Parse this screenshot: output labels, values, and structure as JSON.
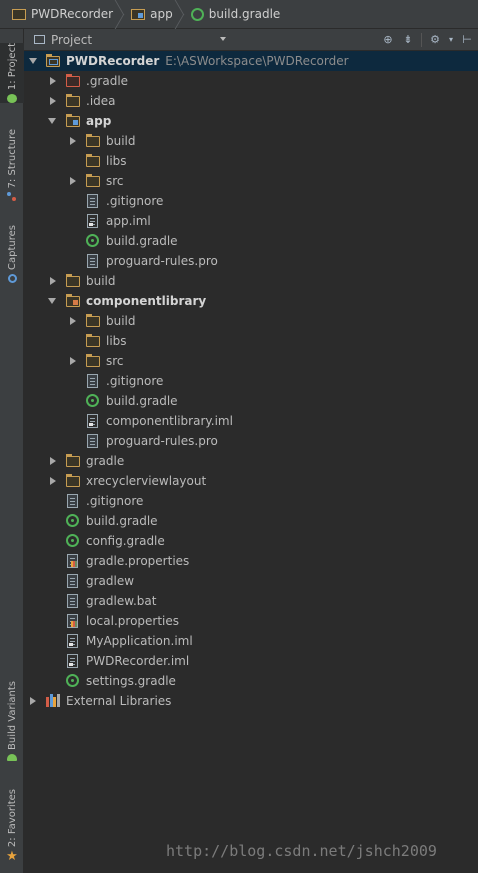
{
  "breadcrumb": {
    "items": [
      "PWDRecorder",
      "app",
      "build.gradle"
    ]
  },
  "tool_strip": {
    "tabs": [
      {
        "label": "1: Project",
        "icon": "android-project-icon",
        "active": true
      },
      {
        "label": "7: Structure",
        "icon": "structure-icon",
        "active": false
      },
      {
        "label": "Captures",
        "icon": "captures-icon",
        "active": false
      },
      {
        "label": "Build Variants",
        "icon": "android-icon",
        "active": false
      },
      {
        "label": "2: Favorites",
        "icon": "star-icon",
        "active": false
      }
    ]
  },
  "project_view": {
    "view_mode": "Project",
    "header_icons": [
      "locate-icon",
      "collapse-all-icon",
      "settings-gear-icon",
      "hide-panel-icon"
    ]
  },
  "tree": {
    "root_name": "PWDRecorder",
    "root_path": "E:\\ASWorkspace\\PWDRecorder",
    "items": [
      {
        "label": ".gradle",
        "icon": "folder-excluded-icon",
        "depth": 1,
        "arrow": "right"
      },
      {
        "label": ".idea",
        "icon": "folder-icon",
        "depth": 1,
        "arrow": "right"
      },
      {
        "label": "app",
        "icon": "module-folder-icon",
        "depth": 1,
        "arrow": "down",
        "bold": true
      },
      {
        "label": "build",
        "icon": "folder-icon",
        "depth": 2,
        "arrow": "right"
      },
      {
        "label": "libs",
        "icon": "folder-icon",
        "depth": 2,
        "arrow": "none"
      },
      {
        "label": "src",
        "icon": "folder-icon",
        "depth": 2,
        "arrow": "right"
      },
      {
        "label": ".gitignore",
        "icon": "text-file-icon",
        "depth": 2,
        "arrow": "none"
      },
      {
        "label": "app.iml",
        "icon": "iml-file-icon",
        "depth": 2,
        "arrow": "none"
      },
      {
        "label": "build.gradle",
        "icon": "gradle-icon",
        "depth": 2,
        "arrow": "none"
      },
      {
        "label": "proguard-rules.pro",
        "icon": "text-file-icon",
        "depth": 2,
        "arrow": "none"
      },
      {
        "label": "build",
        "icon": "folder-icon",
        "depth": 1,
        "arrow": "right"
      },
      {
        "label": "componentlibrary",
        "icon": "library-module-folder-icon",
        "depth": 1,
        "arrow": "down",
        "bold": true
      },
      {
        "label": "build",
        "icon": "folder-icon",
        "depth": 2,
        "arrow": "right"
      },
      {
        "label": "libs",
        "icon": "folder-icon",
        "depth": 2,
        "arrow": "none"
      },
      {
        "label": "src",
        "icon": "folder-icon",
        "depth": 2,
        "arrow": "right"
      },
      {
        "label": ".gitignore",
        "icon": "text-file-icon",
        "depth": 2,
        "arrow": "none"
      },
      {
        "label": "build.gradle",
        "icon": "gradle-icon",
        "depth": 2,
        "arrow": "none"
      },
      {
        "label": "componentlibrary.iml",
        "icon": "iml-file-icon",
        "depth": 2,
        "arrow": "none"
      },
      {
        "label": "proguard-rules.pro",
        "icon": "text-file-icon",
        "depth": 2,
        "arrow": "none"
      },
      {
        "label": "gradle",
        "icon": "folder-icon",
        "depth": 1,
        "arrow": "right"
      },
      {
        "label": "xrecyclerviewlayout",
        "icon": "folder-icon",
        "depth": 1,
        "arrow": "right"
      },
      {
        "label": ".gitignore",
        "icon": "text-file-icon",
        "depth": 1,
        "arrow": "none"
      },
      {
        "label": "build.gradle",
        "icon": "gradle-icon",
        "depth": 1,
        "arrow": "none"
      },
      {
        "label": "config.gradle",
        "icon": "gradle-icon",
        "depth": 1,
        "arrow": "none"
      },
      {
        "label": "gradle.properties",
        "icon": "properties-file-icon",
        "depth": 1,
        "arrow": "none"
      },
      {
        "label": "gradlew",
        "icon": "text-file-icon",
        "depth": 1,
        "arrow": "none"
      },
      {
        "label": "gradlew.bat",
        "icon": "text-file-icon",
        "depth": 1,
        "arrow": "none"
      },
      {
        "label": "local.properties",
        "icon": "properties-file-icon",
        "depth": 1,
        "arrow": "none"
      },
      {
        "label": "MyApplication.iml",
        "icon": "iml-file-icon",
        "depth": 1,
        "arrow": "none"
      },
      {
        "label": "PWDRecorder.iml",
        "icon": "iml-file-icon",
        "depth": 1,
        "arrow": "none"
      },
      {
        "label": "settings.gradle",
        "icon": "gradle-icon",
        "depth": 1,
        "arrow": "none"
      },
      {
        "label": "External Libraries",
        "icon": "external-libraries-icon",
        "depth": 0,
        "arrow": "right"
      }
    ]
  },
  "watermark": "http://blog.csdn.net/jshch2009",
  "colors": {
    "background": "#2b2b2b",
    "panel": "#3c3f41",
    "selection": "#0d293e",
    "folder": "#c79d52",
    "excluded_folder": "#d35d47",
    "gradle_green": "#4fb157",
    "module_blue": "#5f9ad8"
  }
}
